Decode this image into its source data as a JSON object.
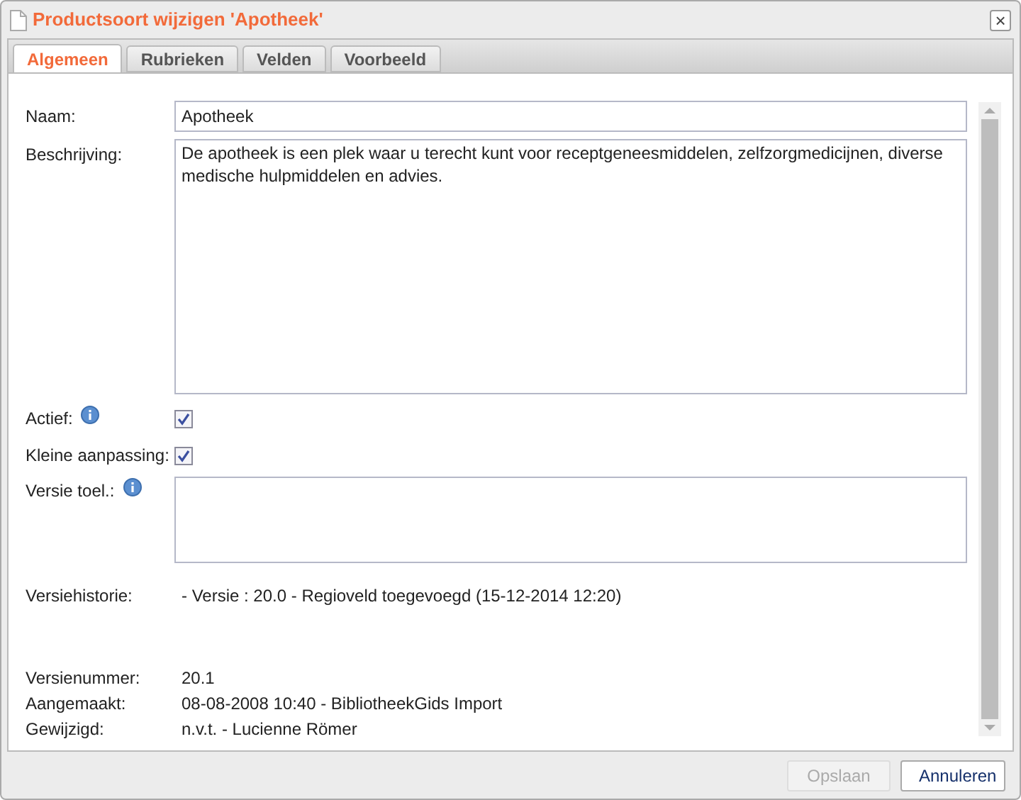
{
  "window": {
    "title": "Productsoort wijzigen 'Apotheek'",
    "close": "×"
  },
  "tabs": [
    {
      "label": "Algemeen",
      "selected": true
    },
    {
      "label": "Rubrieken",
      "selected": false
    },
    {
      "label": "Velden",
      "selected": false
    },
    {
      "label": "Voorbeeld",
      "selected": false
    }
  ],
  "form": {
    "name": {
      "label": "Naam:",
      "value": "Apotheek"
    },
    "description": {
      "label": "Beschrijving:",
      "value": "De apotheek is een plek waar u terecht kunt voor receptgeneesmiddelen, zelfzorgmedicijnen, diverse medische hulpmiddelen en advies."
    },
    "checkboxes": [
      {
        "label": "Actief:",
        "info": true,
        "checked": true
      },
      {
        "label": "Kleine aanpassing:",
        "info": false,
        "checked": true
      }
    ],
    "version_note": {
      "label": "Versie toel.:",
      "info": true
    },
    "history": {
      "label": "Versiehistorie:",
      "value": "- Versie : 20.0 - Regioveld toegevoegd (15-12-2014 12:20)"
    },
    "meta": [
      {
        "label": "Versienummer:",
        "value": "20.1"
      },
      {
        "label": "Aangemaakt:",
        "value": "08-08-2008 10:40 - BibliotheekGids Import"
      },
      {
        "label": "Gewijzigd:",
        "value": "n.v.t. - Lucienne Römer"
      }
    ]
  },
  "buttons": [
    {
      "label": "Opslaan",
      "disabled": true
    },
    {
      "label": "Annuleren",
      "disabled": false
    }
  ]
}
